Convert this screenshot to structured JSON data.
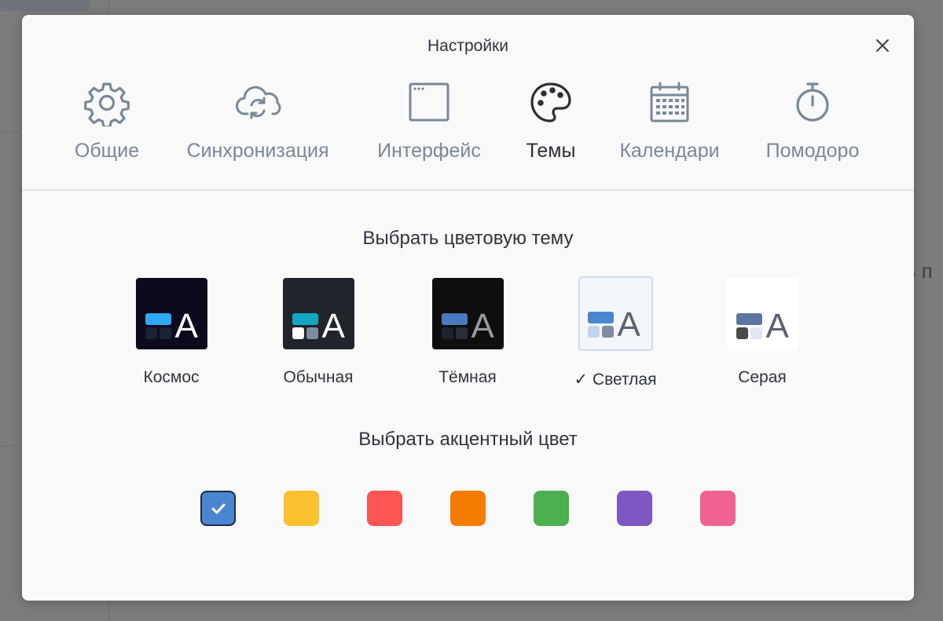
{
  "modal": {
    "title": "Настройки",
    "close_icon": "close-icon"
  },
  "tabs": [
    {
      "label": "Общие",
      "icon": "gear-icon",
      "active": false
    },
    {
      "label": "Синхронизация",
      "icon": "cloud-sync-icon",
      "active": false
    },
    {
      "label": "Интерфейс",
      "icon": "window-icon",
      "active": false
    },
    {
      "label": "Темы",
      "icon": "palette-icon",
      "active": true
    },
    {
      "label": "Календари",
      "icon": "calendar-icon",
      "active": false
    },
    {
      "label": "Помодоро",
      "icon": "stopwatch-icon",
      "active": false
    }
  ],
  "themes_section": {
    "title": "Выбрать цветовую тему",
    "themes": [
      {
        "name": "Космос",
        "selected": false,
        "bg": "#0e0a1e",
        "top": "#2ba9f3",
        "sq1": "#1b2235",
        "sq2": "#1b2235",
        "letter_color": "#ffffff",
        "letter": "A"
      },
      {
        "name": "Обычная",
        "selected": false,
        "bg": "#22242b",
        "top": "#13a6c2",
        "sq1": "#ffffff",
        "sq2": "#7f8ca2",
        "letter_color": "#ffffff",
        "letter": "A"
      },
      {
        "name": "Тёмная",
        "selected": false,
        "bg": "#0e0e0e",
        "top": "#4a79bd",
        "sq1": "#1b2230",
        "sq2": "#2a2e36",
        "letter_color": "#9a9a9a",
        "letter": "A"
      },
      {
        "name": "Светлая",
        "selected": true,
        "selected_mark": "✓ ",
        "bg": "#f3f6fa",
        "top": "#4a86cf",
        "sq1": "#c3d4ea",
        "sq2": "#7f8ca2",
        "letter_color": "#5b6270",
        "letter": "A"
      },
      {
        "name": "Серая",
        "selected": false,
        "bg": "#ffffff",
        "top": "#5b76a0",
        "sq1": "#4a4a4a",
        "sq2": "#dfe6f0",
        "letter_color": "#5b6270",
        "letter": "A"
      }
    ]
  },
  "accent_section": {
    "title": "Выбрать акцентный цвет",
    "colors": [
      {
        "color": "#4a86cf",
        "selected": true
      },
      {
        "color": "#fbc02d",
        "selected": false
      },
      {
        "color": "#fd5454",
        "selected": false
      },
      {
        "color": "#f57c00",
        "selected": false
      },
      {
        "color": "#4caf50",
        "selected": false
      },
      {
        "color": "#7e57c2",
        "selected": false
      },
      {
        "color": "#f06292",
        "selected": false
      }
    ],
    "check_icon": "check-icon"
  },
  "background_app": {
    "partial_text": "ть п"
  }
}
